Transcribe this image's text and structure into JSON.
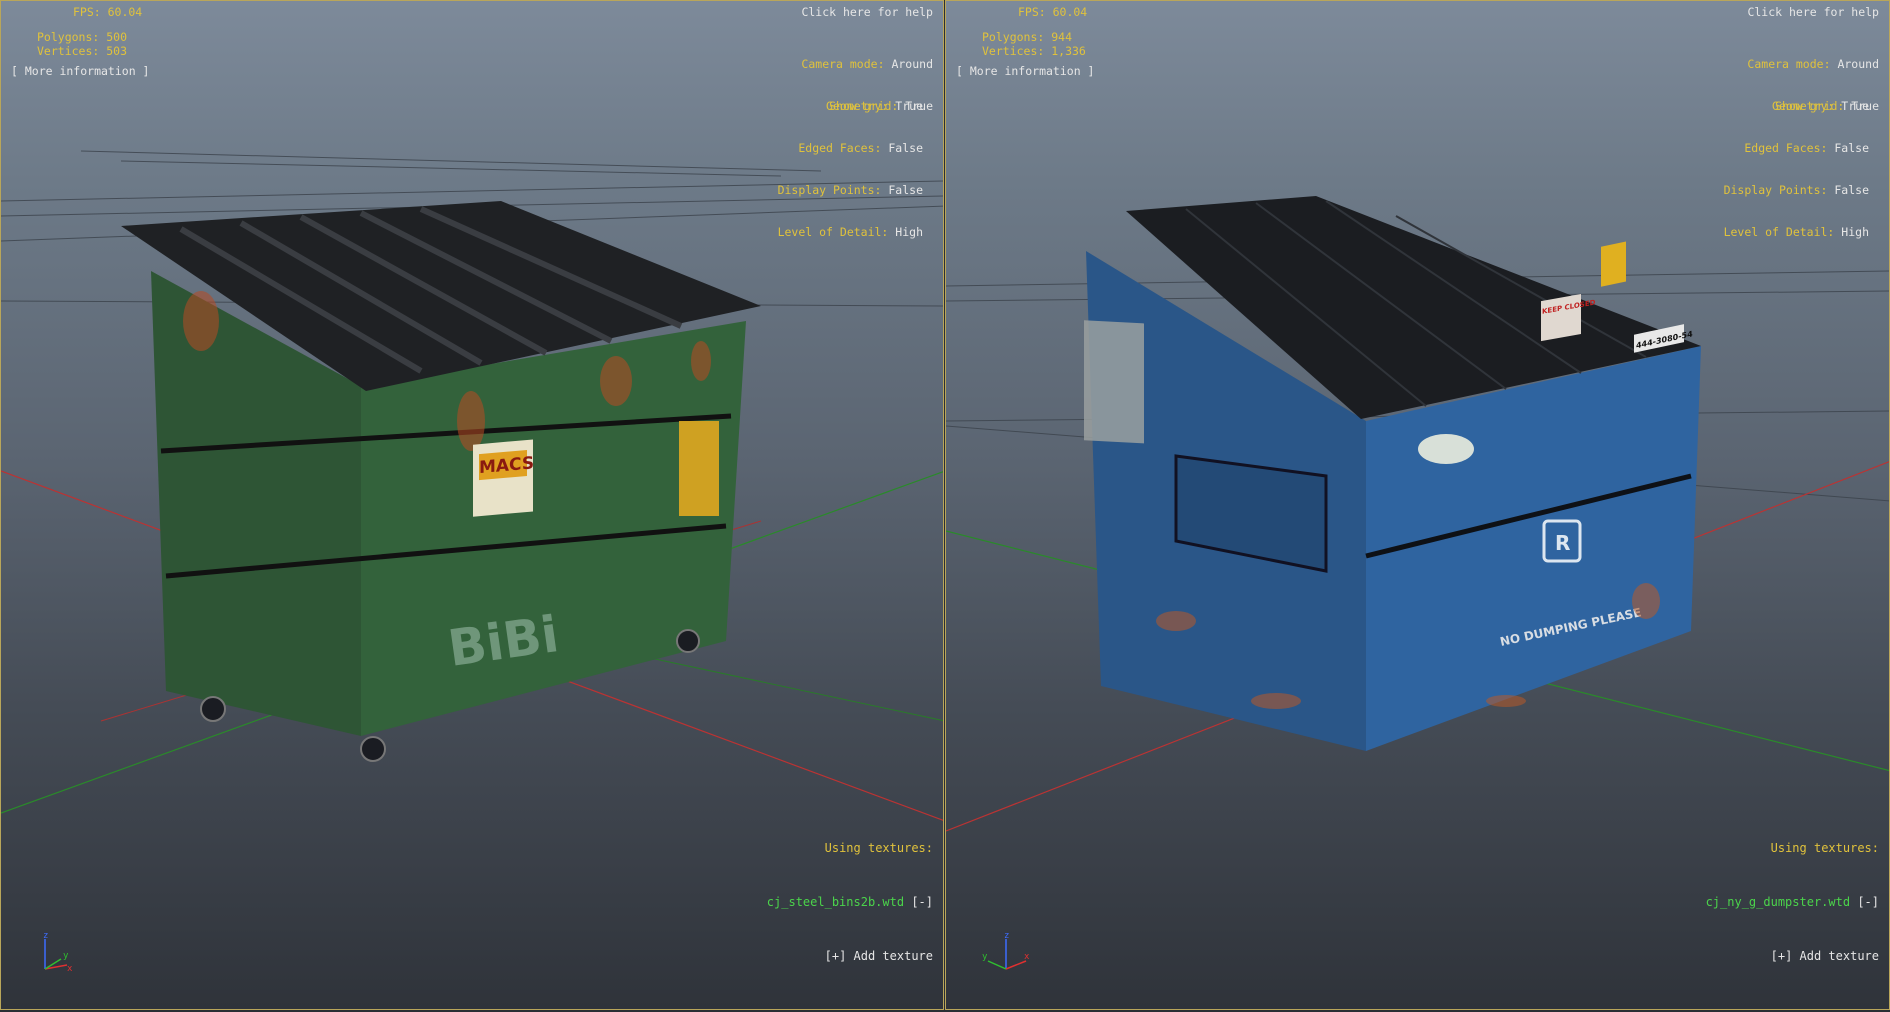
{
  "left": {
    "fps": "FPS: 60.04",
    "polygons": "Polygons: 500",
    "vertices": "Vertices: 503",
    "more_info": "[ More information ]",
    "help": "Click here for help",
    "camera_mode_key": "Camera mode:",
    "camera_mode_val": "Around",
    "show_grid_key": "Show grid:",
    "show_grid_val": "True",
    "geometry_key": "Geometry:",
    "geometry_val": "True",
    "edged_key": "Edged Faces:",
    "edged_val": "False",
    "points_key": "Display Points:",
    "points_val": "False",
    "lod_key": "Level of Detail:",
    "lod_val": "High",
    "textures_title": "Using textures:",
    "texture_file": "cj_steel_bins2b.wtd",
    "texture_remove": "[-]",
    "add_texture": "[+] Add texture",
    "sticker_text": "MACS",
    "graffiti_text": "BiBi",
    "model_color": "#2f5a37"
  },
  "right": {
    "fps": "FPS: 60.04",
    "polygons": "Polygons: 944",
    "vertices": "Vertices: 1,336",
    "more_info": "[ More information ]",
    "help": "Click here for help",
    "camera_mode_key": "Camera mode:",
    "camera_mode_val": "Around",
    "show_grid_key": "Show grid:",
    "show_grid_val": "True",
    "geometry_key": "Geometry:",
    "geometry_val": "True",
    "edged_key": "Edged Faces:",
    "edged_val": "False",
    "points_key": "Display Points:",
    "points_val": "False",
    "lod_key": "Level of Detail:",
    "lod_val": "High",
    "textures_title": "Using textures:",
    "texture_file": "cj_ny_g_dumpster.wtd",
    "texture_remove": "[-]",
    "add_texture": "[+] Add texture",
    "keep_closed": "KEEP CLOSED",
    "phone_text": "444-3080-54",
    "no_dumping": "NO DUMPING PLEASE",
    "logo_letter": "R",
    "model_color": "#2c5f97"
  },
  "axes": {
    "x": "x",
    "y": "y",
    "z": "z"
  },
  "colors": {
    "hud_key": "#e0c23c",
    "hud_value": "#e6e6e6",
    "texture_file": "#4bd44b",
    "border": "#b9a65a"
  }
}
